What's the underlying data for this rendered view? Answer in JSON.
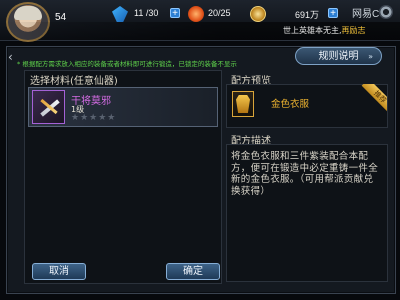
{
  "header": {
    "level": "54",
    "stamina": "11 /30",
    "energy": "20/25",
    "gold": "691万",
    "brand": "网易CC",
    "marquee_prefix": "世上英雄本无主,",
    "marquee_highlight": "再励志"
  },
  "tip": "* 根据配方需求放入相应的装备或者材料即可进行锻造，已锁定的装备不显示",
  "rules_button": "规则说明",
  "materials": {
    "title": "选择材料(任意仙器)",
    "item_name": "干将莫邪",
    "item_level": "1级",
    "stars": "★★★★★"
  },
  "preview": {
    "title": "配方预览",
    "item_name": "金色衣服",
    "ribbon": "推荐"
  },
  "description": {
    "title": "配方描述",
    "text": "将金色衣服和三件紫装配合本配方，便可在锻造中必定重铸一件全新的金色衣服。（可用帮派贡献兑换获得）"
  },
  "buttons": {
    "cancel": "取消",
    "confirm": "确定"
  },
  "colors": {
    "tip_green": "#5fd14b",
    "purple_quality": "#d36be3",
    "gold_quality": "#f0b530"
  }
}
